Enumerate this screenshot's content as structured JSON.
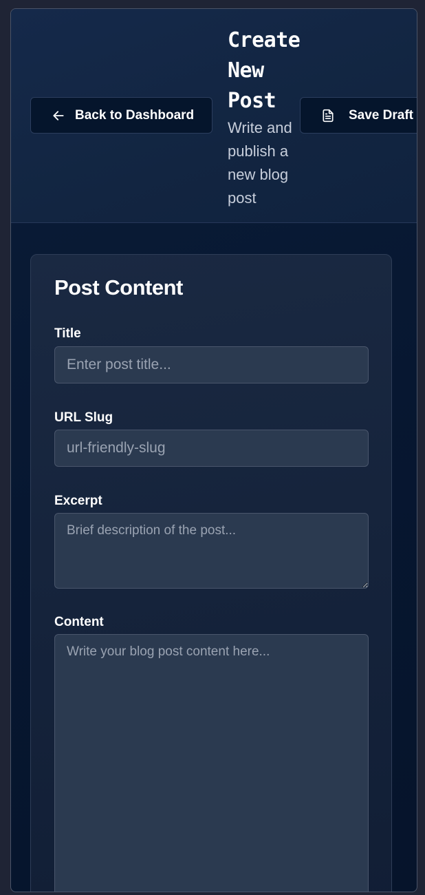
{
  "header": {
    "back_label": "Back to Dashboard",
    "back_icon": "arrow-left-icon",
    "title_lines": [
      "Create",
      "New",
      "Post"
    ],
    "subtitle_lines": [
      "Write and",
      "publish a",
      "new blog",
      "post"
    ],
    "save_draft_label": "Save Draft",
    "save_draft_icon": "document-icon"
  },
  "form": {
    "section_title": "Post Content",
    "title_label": "Title",
    "title_placeholder": "Enter post title...",
    "title_value": "",
    "slug_label": "URL Slug",
    "slug_placeholder": "url-friendly-slug",
    "slug_value": "",
    "excerpt_label": "Excerpt",
    "excerpt_placeholder": "Brief description of the post...",
    "excerpt_value": "",
    "content_label": "Content",
    "content_placeholder": "Write your blog post content here...",
    "content_value": ""
  },
  "colors": {
    "page_bg": "#1f2435",
    "header_bg": "#15294a",
    "button_bg": "#05152c",
    "card_bg": "#1a2942",
    "input_bg": "#2b3a50",
    "text": "#ffffff",
    "muted_text": "#c7cedb"
  }
}
